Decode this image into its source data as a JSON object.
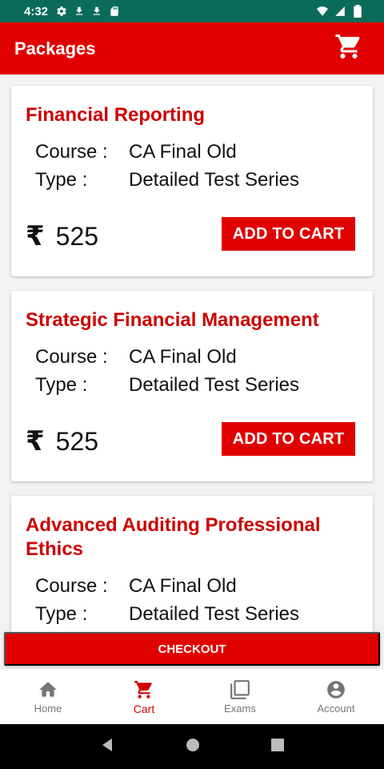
{
  "status_bar": {
    "time": "4:32",
    "left_icons": [
      "gear-icon",
      "download-icon",
      "download-icon",
      "sd-card-icon"
    ],
    "right_icons": [
      "wifi-icon",
      "signal-icon",
      "battery-icon"
    ],
    "background": "#0b6b59"
  },
  "app_bar": {
    "title": "Packages",
    "cart_icon": "cart-icon",
    "background": "#e00000"
  },
  "packages": [
    {
      "title": "Financial Reporting",
      "course_label": "Course :",
      "course_value": "CA Final Old",
      "type_label": "Type :",
      "type_value": "Detailed Test Series",
      "currency": "₹",
      "price": "525",
      "button": "ADD TO CART"
    },
    {
      "title": "Strategic Financial Management",
      "course_label": "Course :",
      "course_value": "CA Final Old",
      "type_label": "Type :",
      "type_value": "Detailed Test Series",
      "currency": "₹",
      "price": "525",
      "button": "ADD TO CART"
    },
    {
      "title": "Advanced Auditing Professional Ethics",
      "course_label": "Course :",
      "course_value": "CA Final Old",
      "type_label": "Type :",
      "type_value": "Detailed Test Series"
    }
  ],
  "checkout_label": "CHECKOUT",
  "bottom_nav": {
    "items": [
      {
        "label": "Home",
        "icon": "home-icon",
        "active": false
      },
      {
        "label": "Cart",
        "icon": "cart-icon",
        "active": true
      },
      {
        "label": "Exams",
        "icon": "exams-icon",
        "active": false
      },
      {
        "label": "Account",
        "icon": "account-icon",
        "active": false
      }
    ]
  },
  "colors": {
    "accent": "#e00000",
    "title_red": "#cc0000",
    "inactive_nav": "#757575"
  }
}
